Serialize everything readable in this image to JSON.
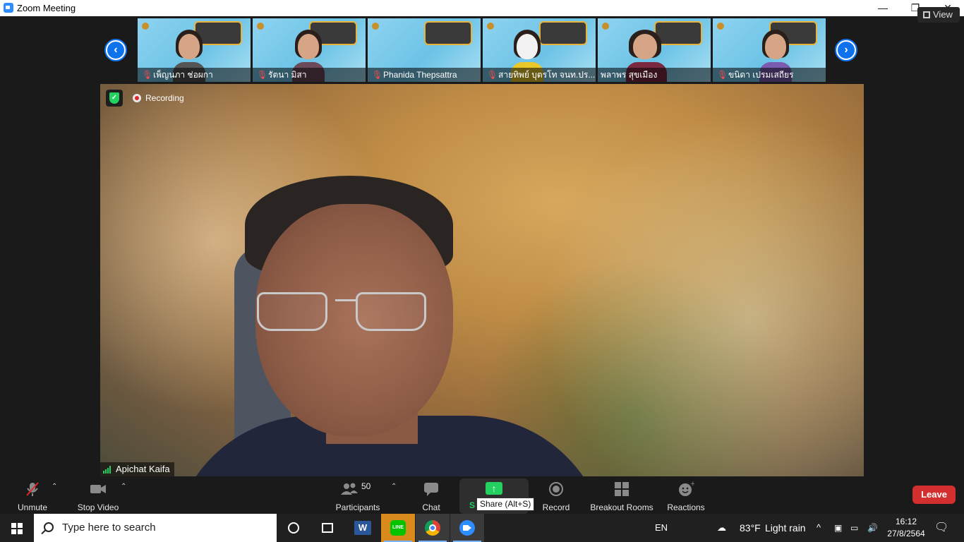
{
  "window": {
    "title": "Zoom Meeting",
    "controls": [
      "—",
      "❐",
      "✕"
    ]
  },
  "gallery": {
    "view_label": "View",
    "participants": [
      {
        "name": "เพ็ญนภา ช่อผกา",
        "muted": true
      },
      {
        "name": "รัตนา มิสา",
        "muted": true
      },
      {
        "name": "Phanida Thepsattra",
        "muted": true
      },
      {
        "name": "สายทิพย์ บุตรโท จนท.ปร...",
        "muted": true
      },
      {
        "name": "พลาพร สุขเมือง",
        "muted": false
      },
      {
        "name": "ขนิดา เปรมเสถียร",
        "muted": true
      }
    ]
  },
  "main_video": {
    "recording_label": "Recording",
    "speaker_name": "Apichat Kaifa"
  },
  "toolbar": {
    "unmute_label": "Unmute",
    "stop_video_label": "Stop Video",
    "participants_label": "Participants",
    "participants_count": "50",
    "chat_label": "Chat",
    "share_label_partial": "S",
    "share_tooltip": "Share (Alt+S)",
    "record_label": "Record",
    "breakout_label": "Breakout Rooms",
    "reactions_label": "Reactions",
    "leave_label": "Leave",
    "colors": {
      "share_green": "#23d160",
      "leave_red": "#d32f2f"
    }
  },
  "taskbar": {
    "search_placeholder": "Type here to search",
    "language": "EN",
    "temperature": "83°F",
    "weather": "Light rain",
    "time": "16:12",
    "date": "27/8/2564",
    "apps": [
      "cortana",
      "task-view",
      "word",
      "line",
      "chrome",
      "zoom"
    ]
  }
}
